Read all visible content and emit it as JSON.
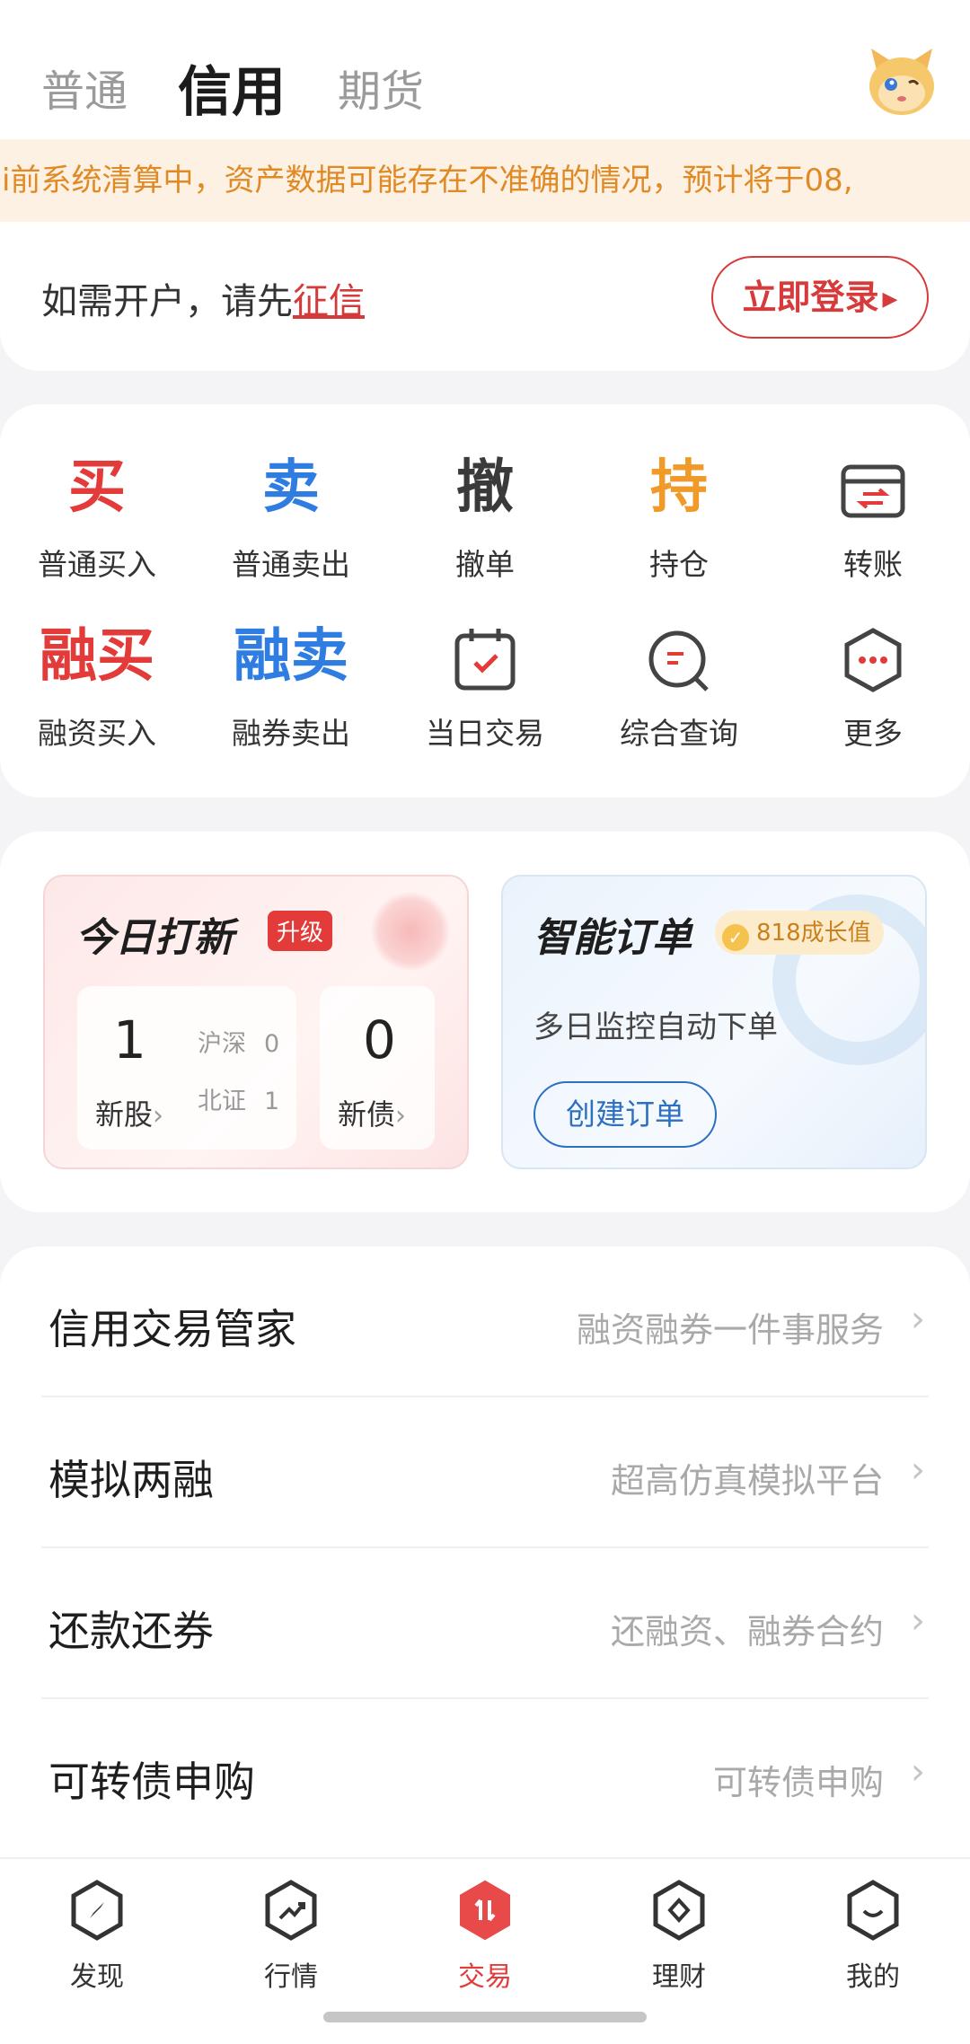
{
  "tabs": [
    {
      "label": "普通"
    },
    {
      "label": "信用"
    },
    {
      "label": "期货"
    }
  ],
  "notice": {
    "text": "i前系统清算中，资产数据可能存在不准确的情况，预计将于08,"
  },
  "login": {
    "prompt": "如需开户，请先",
    "link": "征信",
    "button": "立即登录"
  },
  "actions": [
    {
      "glyph": "买",
      "label": "普通买入",
      "icon": "buy-glyph",
      "color": "#e33a3a"
    },
    {
      "glyph": "卖",
      "label": "普通卖出",
      "icon": "sell-glyph",
      "color": "#2f7de1"
    },
    {
      "glyph": "撤",
      "label": "撤单",
      "icon": "cancel-glyph",
      "color": "#3a3a3a"
    },
    {
      "glyph": "持",
      "label": "持仓",
      "icon": "hold-glyph",
      "color": "#f09a2a"
    },
    {
      "label": "转账",
      "icon": "transfer-icon"
    },
    {
      "glyph": "融买",
      "label": "融资买入",
      "icon": "margin-buy-glyph",
      "color": "#e33a3a"
    },
    {
      "glyph": "融卖",
      "label": "融券卖出",
      "icon": "short-sell-glyph",
      "color": "#2f7de1"
    },
    {
      "label": "当日交易",
      "icon": "calendar-check-icon"
    },
    {
      "label": "综合查询",
      "icon": "query-search-icon"
    },
    {
      "label": "更多",
      "icon": "more-dots-icon"
    }
  ],
  "ipo": {
    "title": "今日打新",
    "badge": "升级",
    "stocks_count": "1",
    "stocks_label": "新股",
    "hs_label": "沪深",
    "hs_value": "0",
    "bz_label": "北证",
    "bz_value": "1",
    "bonds_count": "0",
    "bonds_label": "新债"
  },
  "smart_order": {
    "title": "智能订单",
    "badge": "818成长值",
    "desc": "多日监控自动下单",
    "button": "创建订单"
  },
  "list": [
    {
      "title": "信用交易管家",
      "desc": "融资融券一件事服务"
    },
    {
      "title": "模拟两融",
      "desc": "超高仿真模拟平台"
    },
    {
      "title": "还款还券",
      "desc": "还融资、融券合约"
    },
    {
      "title": "可转债申购",
      "desc": "可转债申购"
    }
  ],
  "nav": [
    {
      "label": "发现",
      "icon": "compass-icon"
    },
    {
      "label": "行情",
      "icon": "trend-chart-icon"
    },
    {
      "label": "交易",
      "icon": "trade-arrows-icon"
    },
    {
      "label": "理财",
      "icon": "wealth-diamond-icon"
    },
    {
      "label": "我的",
      "icon": "profile-smile-icon"
    }
  ],
  "colors": {
    "accent_red": "#e33a3a",
    "accent_blue": "#2f7de1",
    "accent_orange": "#f09a2a",
    "notice_text": "#e08a26"
  }
}
